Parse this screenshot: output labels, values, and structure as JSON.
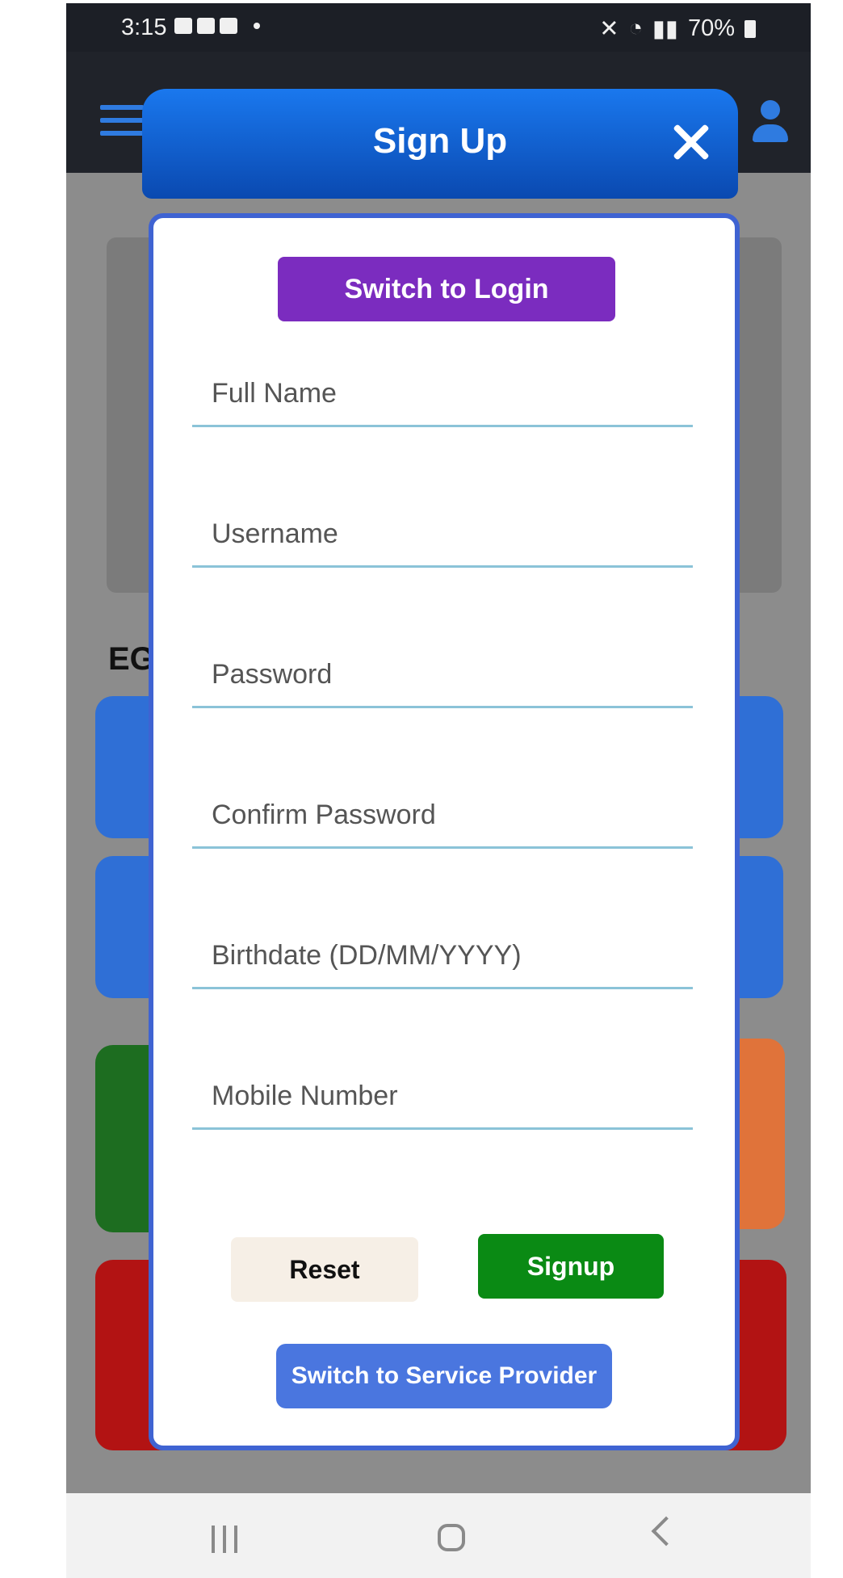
{
  "status_bar": {
    "time": "3:15",
    "battery": "70%"
  },
  "background": {
    "heading": "EG",
    "tile_colors": [
      "#2f6fd6",
      "#2f6fd6",
      "#1d6d20",
      "#e0733a",
      "#b21313"
    ]
  },
  "modal": {
    "title": "Sign Up",
    "switch_login_label": "Switch to Login",
    "fields": {
      "full_name": "Full Name",
      "username": "Username",
      "password": "Password",
      "confirm_password": "Confirm Password",
      "birthdate": "Birthdate (DD/MM/YYYY)",
      "mobile": "Mobile Number"
    },
    "reset_label": "Reset",
    "signup_label": "Signup",
    "switch_provider_label": "Switch to Service Provider"
  },
  "colors": {
    "header": "#1a78ee",
    "login_button": "#7b2cbf",
    "signup_button": "#0a8a14",
    "provider_button": "#4a76df",
    "modal_border": "#3f63d2"
  }
}
